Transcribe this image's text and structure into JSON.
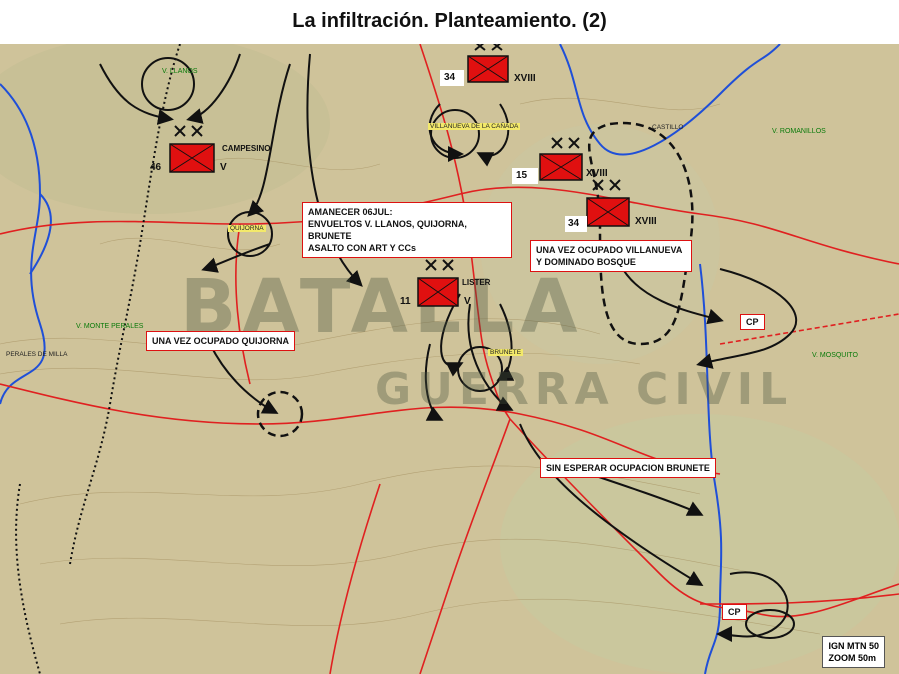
{
  "title": "La infiltración. Planteamiento. (2)",
  "units": [
    {
      "number": "34",
      "echelon": "XVIII"
    },
    {
      "number": "46",
      "echelon": "V",
      "name": "CAMPESINO"
    },
    {
      "number": "15",
      "echelon": "XVIII"
    },
    {
      "number": "34",
      "echelon": "XVIII"
    },
    {
      "number": "11",
      "echelon": "V",
      "name": "LISTER"
    }
  ],
  "labels": {
    "amanecer": "AMANECER 06JUL:\nENVUELTOS V. LLANOS, QUIJORNA, BRUNETE\nASALTO CON ART Y CCs",
    "villanueva": "UNA VEZ OCUPADO  VILLANUEVA\nY DOMINADO BOSQUE",
    "quijorna": "UNA VEZ OCUPADO QUIJORNA",
    "brunete": "SIN ESPERAR OCUPACION BRUNETE"
  },
  "cp": [
    "CP",
    "CP"
  ],
  "towns": {
    "v_llanos": "V. LLANOS",
    "quijorna": "QUIJORNA",
    "villanueva": "VILLANUEVA DE LA CAÑADA",
    "brunete": "BRUNETE",
    "v_romanillos": "V. ROMANILLOS",
    "castillo": "CASTILLO",
    "v_monte_perales": "V. MONTE PERALES",
    "v_mosquito": "V. MOSQUITO",
    "perales": "PERALES DE MILLA"
  },
  "scale": {
    "line1": "IGN MTN 50",
    "line2": "ZOOM 50m"
  },
  "watermark": {
    "line1": "BATALLA",
    "line2": "GUERRA CIVIL"
  },
  "colors": {
    "unit_fill": "#e01010",
    "road": "#e02020",
    "river": "#1f4fd8",
    "border_label": "#dd1111",
    "map_bg": "#cfc39a"
  }
}
